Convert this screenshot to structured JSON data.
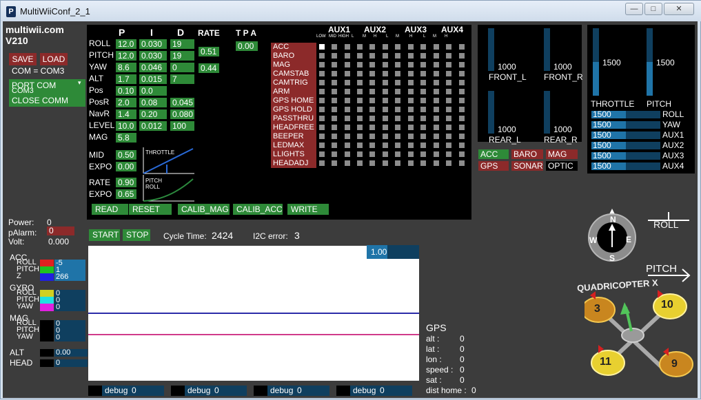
{
  "window": {
    "title": "MultiWiiConf_2_1",
    "app_icon": "P",
    "min": "—",
    "max": "□",
    "close": "✕"
  },
  "brand": {
    "name": "multiwii.com",
    "version": "V210"
  },
  "com": {
    "save": "SAVE",
    "load": "LOAD",
    "status": "COM = COM3",
    "port": "PORT COM",
    "port_value": "COM3",
    "close": "CLOSE COMM"
  },
  "pid": {
    "headers": {
      "p": "P",
      "i": "I",
      "d": "D",
      "rate": "RATE",
      "tpa": "T P A"
    },
    "rows": [
      {
        "name": "ROLL",
        "p": "12.0",
        "i": "0.030",
        "d": "19"
      },
      {
        "name": "PITCH",
        "p": "12.0",
        "i": "0.030",
        "d": "19"
      },
      {
        "name": "YAW",
        "p": "8.6",
        "i": "0.046",
        "d": "0"
      },
      {
        "name": "ALT",
        "p": "1.7",
        "i": "0.015",
        "d": "7"
      },
      {
        "name": "Pos",
        "p": "0.10",
        "i": "0.0",
        "d": ""
      },
      {
        "name": "PosR",
        "p": "2.0",
        "i": "0.08",
        "d": "0.045"
      },
      {
        "name": "NavR",
        "p": "1.4",
        "i": "0.20",
        "d": "0.080"
      },
      {
        "name": "LEVEL",
        "p": "10.0",
        "i": "0.012",
        "d": "100"
      },
      {
        "name": "MAG",
        "p": "5.8",
        "i": "",
        "d": ""
      }
    ],
    "rate_rp": "0.51",
    "rate_yaw": "0.44",
    "tpa": "0.00",
    "throttle": {
      "mid_label": "MID",
      "mid": "0.50",
      "expo_label": "EXPO",
      "expo": "0.00",
      "curve_label": "THROTTLE"
    },
    "rc": {
      "rate_label": "RATE",
      "rate": "0.90",
      "expo_label": "EXPO",
      "expo": "0.65",
      "curve_label1": "PITCH",
      "curve_label2": "ROLL"
    },
    "buttons": {
      "read": "READ",
      "reset": "RESET",
      "calib_mag": "CALIB_MAG",
      "calib_acc": "CALIB_ACC",
      "write": "WRITE"
    }
  },
  "aux": {
    "headers": [
      "AUX1",
      "AUX2",
      "AUX3",
      "AUX4"
    ],
    "sub": [
      "LOW",
      "MID",
      "HIGH",
      "L",
      "M",
      "H",
      "L",
      "M",
      "H",
      "L",
      "M",
      "H"
    ],
    "modes": [
      "ACC",
      "BARO",
      "MAG",
      "CAMSTAB",
      "CAMTRIG",
      "ARM",
      "GPS HOME",
      "GPS HOLD",
      "PASSTHRU",
      "HEADFREE",
      "BEEPER",
      "LEDMAX",
      "LLIGHTS",
      "HEADADJ"
    ]
  },
  "motors": {
    "front_l": {
      "label": "FRONT_L",
      "value": "1000",
      "level": 0.0
    },
    "front_r": {
      "label": "FRONT_R",
      "value": "1000",
      "level": 0.0
    },
    "rear_l": {
      "label": "REAR_L",
      "value": "1000",
      "level": 0.0
    },
    "rear_r": {
      "label": "REAR_R",
      "value": "1000",
      "level": 0.0
    }
  },
  "sensors": {
    "acc": "ACC",
    "baro": "BARO",
    "mag": "MAG",
    "gps": "GPS",
    "sonar": "SONAR",
    "optic": "OPTIC"
  },
  "rc_in": {
    "throttle": {
      "label": "THROTTLE",
      "value": "1500",
      "level": 0.5
    },
    "pitch": {
      "label": "PITCH",
      "value": "1500",
      "level": 0.5
    },
    "channels": [
      {
        "label": "ROLL",
        "value": "1500",
        "level": 0.5
      },
      {
        "label": "YAW",
        "value": "1500",
        "level": 0.5
      },
      {
        "label": "AUX1",
        "value": "1500",
        "level": 0.5
      },
      {
        "label": "AUX2",
        "value": "1500",
        "level": 0.5
      },
      {
        "label": "AUX3",
        "value": "1500",
        "level": 0.5
      },
      {
        "label": "AUX4",
        "value": "1500",
        "level": 0.5
      }
    ]
  },
  "power": {
    "power_label": "Power:",
    "power": "0",
    "palarm_label": "pAlarm:",
    "palarm": "0",
    "volt_label": "Volt:",
    "volt": "0.000"
  },
  "monitor": {
    "start": "START",
    "stop": "STOP",
    "cycle_label": "Cycle Time:",
    "cycle": "2424",
    "i2c_label": "I2C error:",
    "i2c": "3",
    "scale": "1.00"
  },
  "raw": {
    "acc": {
      "label": "ACC",
      "roll": "-5",
      "pitch": "1",
      "z": "266"
    },
    "gyro": {
      "label": "GYRO",
      "roll": "0",
      "pitch": "0",
      "yaw": "0"
    },
    "mag": {
      "label": "MAG",
      "roll": "0",
      "pitch": "0",
      "yaw": "0"
    },
    "alt_label": "ALT",
    "alt": "0.00",
    "head_label": "HEAD",
    "head": "0",
    "roll_l": "ROLL",
    "pitch_l": "PITCH",
    "yaw_l": "YAW",
    "z_l": "Z"
  },
  "debug": [
    {
      "label": "debug",
      "value": "0"
    },
    {
      "label": "debug",
      "value": "0"
    },
    {
      "label": "debug",
      "value": "0"
    },
    {
      "label": "debug",
      "value": "0"
    }
  ],
  "gps": {
    "title": "GPS",
    "alt_l": "alt :",
    "alt": "0",
    "lat_l": "lat :",
    "lat": "0",
    "lon_l": "lon :",
    "lon": "0",
    "speed_l": "speed :",
    "speed": "0",
    "sat_l": "sat :",
    "sat": "0",
    "dist_l": "dist home :",
    "dist": "0"
  },
  "attitude": {
    "n": "N",
    "s": "S",
    "e": "E",
    "w": "W",
    "roll": "ROLL",
    "pitch": "PITCH",
    "model": "QUADRICOPTER X",
    "m1": "3",
    "m2": "10",
    "m3": "11",
    "m4": "9"
  },
  "colors": {
    "green": "#2e8a38",
    "red": "#8c2a2a",
    "blue": "#1f74a8",
    "dark_blue": "#0f3f5f",
    "panel": "#000000",
    "bg": "#3c3c3c"
  }
}
